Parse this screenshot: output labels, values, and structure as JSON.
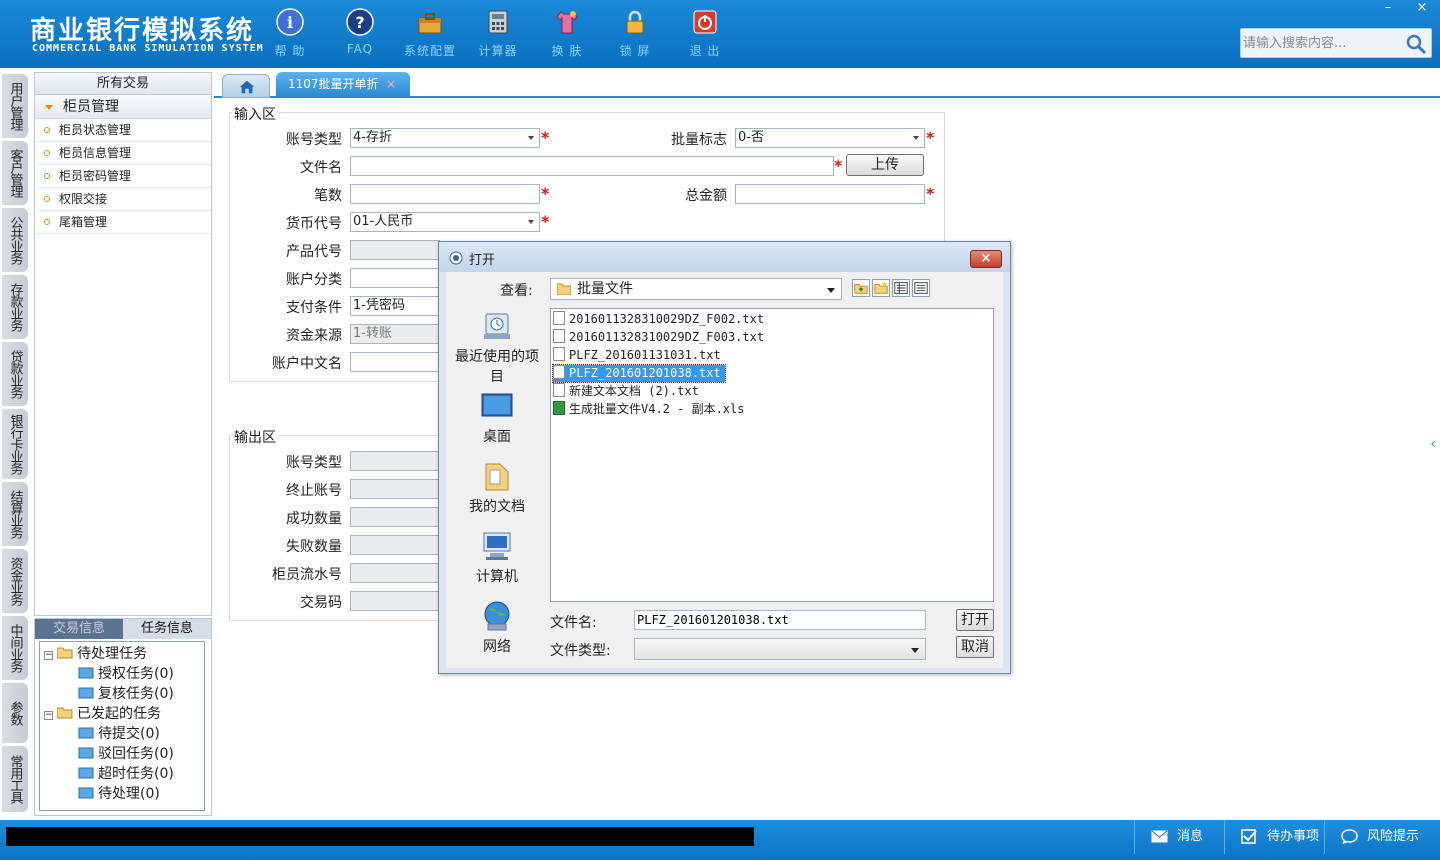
{
  "app": {
    "title": "商业银行模拟系统",
    "subtitle": "COMMERCIAL BANK SIMULATION SYSTEM"
  },
  "toolbar": {
    "help": "帮 助",
    "faq": "FAQ",
    "config": "系统配置",
    "calculator": "计算器",
    "skin": "换 肤",
    "lock": "锁 屏",
    "exit": "退 出"
  },
  "search": {
    "placeholder": "请输入搜索内容..."
  },
  "window_controls": {
    "minimize": "–",
    "close": "×"
  },
  "left_nav": [
    "用户管理",
    "客户管理",
    "公共业务",
    "存款业务",
    "贷款业务",
    "银行卡业务",
    "结算业务",
    "资金业务",
    "中间业务",
    "参数",
    "常用工具"
  ],
  "tree": {
    "header": "所有交易",
    "group": "柜员管理",
    "items": [
      "柜员状态管理",
      "柜员信息管理",
      "柜员密码管理",
      "权限交接",
      "尾箱管理"
    ]
  },
  "tasks": {
    "tab_trade": "交易信息",
    "tab_task": "任务信息",
    "pending": "待处理任务",
    "pending_children": [
      "授权任务(0)",
      "复核任务(0)"
    ],
    "initiated": "已发起的任务",
    "initiated_children": [
      "待提交(0)",
      "驳回任务(0)",
      "超时任务(0)",
      "待处理(0)"
    ]
  },
  "tabs": {
    "active": "1107批量开单折",
    "close": "×"
  },
  "input_section": {
    "title": "输入区",
    "account_type_label": "账号类型",
    "account_type_value": "4-存折",
    "batch_flag_label": "批量标志",
    "batch_flag_value": "0-否",
    "file_name_label": "文件名",
    "file_name_value": "",
    "upload_button": "上传",
    "count_label": "笔数",
    "total_label": "总金额",
    "currency_label": "货币代号",
    "currency_value": "01-人民币",
    "product_label": "产品代号",
    "account_class_label": "账户分类",
    "payment_label": "支付条件",
    "payment_value": "1-凭密码",
    "funds_label": "资金来源",
    "funds_value": "1-转账",
    "cn_name_label": "账户中文名",
    "required_mark": "*"
  },
  "output_section": {
    "title": "输出区",
    "labels": [
      "账号类型",
      "终止账号",
      "成功数量",
      "失败数量",
      "柜员流水号",
      "交易码"
    ]
  },
  "dialog": {
    "title": "打开",
    "close": "×",
    "look_in_label": "查看:",
    "look_in_value": "批量文件",
    "places": [
      "最近使用的项目",
      "桌面",
      "我的文档",
      "计算机",
      "网络"
    ],
    "files": [
      "2016011328310029DZ_F002.txt",
      "2016011328310029DZ_F003.txt",
      "PLFZ_201601131031.txt",
      "PLFZ_201601201038.txt",
      "新建文本文档 (2).txt",
      "生成批量文件V4.2 - 副本.xls"
    ],
    "selected_file_index": 3,
    "filename_label": "文件名:",
    "filename_value": "PLFZ_201601201038.txt",
    "filetype_label": "文件类型:",
    "filetype_value": "",
    "open_button": "打开",
    "cancel_button": "取消"
  },
  "status_bar": {
    "message": "消息",
    "todo": "待办事项",
    "risk": "风险提示"
  },
  "colors": {
    "header_blue": "#0a6fbf",
    "accent_blue": "#2a86d0",
    "required_red": "#e0141e",
    "selection_blue": "#3399ff",
    "tree_accent_orange": "#f08a00"
  }
}
